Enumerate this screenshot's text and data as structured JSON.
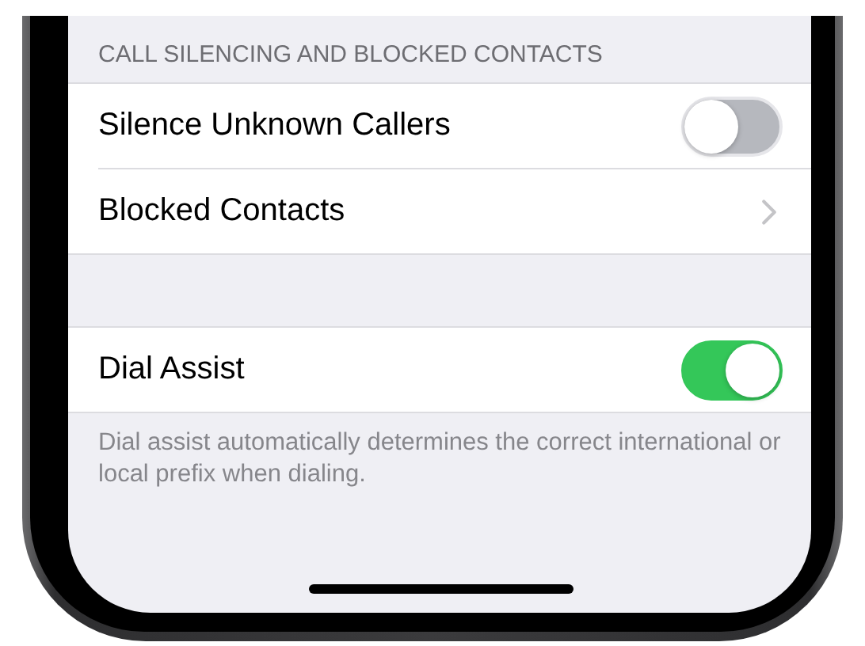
{
  "groups": [
    {
      "header": "CALL SILENCING AND BLOCKED CONTACTS",
      "rows": [
        {
          "kind": "toggle",
          "label": "Silence Unknown Callers",
          "on": false
        },
        {
          "kind": "disclosure",
          "label": "Blocked Contacts"
        }
      ]
    },
    {
      "rows": [
        {
          "kind": "toggle",
          "label": "Dial Assist",
          "on": true
        }
      ],
      "footer": "Dial assist automatically determines the correct international or local prefix when dialing."
    }
  ]
}
